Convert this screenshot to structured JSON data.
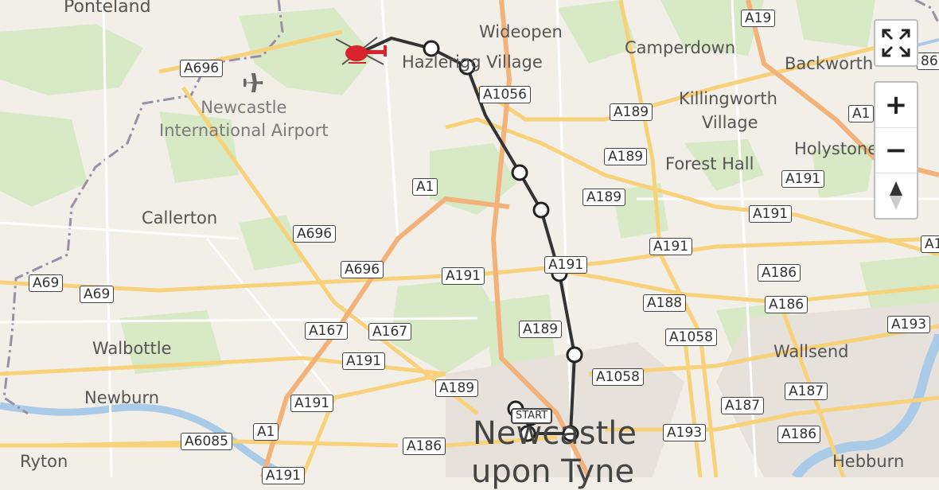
{
  "map": {
    "colors": {
      "land": "#f2efe9",
      "green": "#d8e9c6",
      "urban": "#e6e1da",
      "major_road": "#f7d27a",
      "motorway": "#f3b27a",
      "water": "#a9cbe8",
      "route": "#333333",
      "stop_fill": "#ffffff",
      "helicopter": "#d9232d",
      "border": "#9a8fa8"
    },
    "places": [
      {
        "name": "Ponteland",
        "size": "l"
      },
      {
        "name": "Wideopen",
        "size": "m"
      },
      {
        "name": "Hazlerigg Village",
        "size": "m"
      },
      {
        "name": "Camperdown",
        "size": "m"
      },
      {
        "name": "Backworth",
        "size": "m"
      },
      {
        "name": "Killingworth",
        "size": "m"
      },
      {
        "name": "Village",
        "size": "m"
      },
      {
        "name": "Holystone",
        "size": "m"
      },
      {
        "name": "Forest Hall",
        "size": "m"
      },
      {
        "name": "Callerton",
        "size": "m"
      },
      {
        "name": "Walbottle",
        "size": "m"
      },
      {
        "name": "Newburn",
        "size": "m"
      },
      {
        "name": "Ryton",
        "size": "m"
      },
      {
        "name": "Wallsend",
        "size": "m"
      },
      {
        "name": "Hebburn",
        "size": "m"
      },
      {
        "name": "Newcastle",
        "size": "xl"
      },
      {
        "name": "upon Tyne",
        "size": "xl"
      }
    ],
    "airport": {
      "line1": "Newcastle",
      "line2": "International Airport",
      "icon": "airplane-icon"
    },
    "road_labels": [
      "A19",
      "A696",
      "A1056",
      "A189",
      "A189",
      "A189",
      "A1",
      "A696",
      "A696",
      "A191",
      "A191",
      "A191",
      "A191",
      "A191",
      "A186",
      "A188",
      "A186",
      "A69",
      "A69",
      "A167",
      "A167",
      "A189",
      "A1058",
      "A191",
      "A1058",
      "A193",
      "A187",
      "A191",
      "A189",
      "A1",
      "A6085",
      "A186",
      "A187",
      "A193",
      "A186",
      "A191",
      "A1",
      "86",
      "A1"
    ],
    "start_label": "START",
    "route": {
      "stops": 11,
      "start_marker": "start-flag",
      "end_marker": "helicopter-icon"
    }
  },
  "controls": {
    "fullscreen": "fullscreen-icon",
    "zoom_in": "+",
    "zoom_out": "−",
    "reset_bearing": "compass-icon"
  }
}
